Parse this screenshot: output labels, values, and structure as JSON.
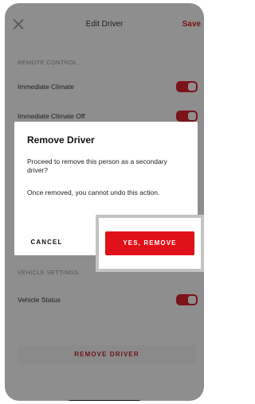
{
  "header": {
    "title": "Edit Driver",
    "save_label": "Save"
  },
  "sections": {
    "remote_control": {
      "label": "REMOTE CONTROL",
      "items": [
        {
          "label": "Immediate Climate",
          "on": true
        },
        {
          "label": "Immediate Climate Off",
          "on": true
        }
      ]
    },
    "vehicle_settings": {
      "label": "VEHICLE SETTINGS",
      "items": [
        {
          "label": "Vehicle Status",
          "on": true
        }
      ]
    }
  },
  "remove_driver_label": "REMOVE DRIVER",
  "dialog": {
    "title": "Remove Driver",
    "body1": "Proceed to remove this person as a secondary driver?",
    "body2": "Once removed, you cannot undo this action.",
    "cancel_label": "CANCEL",
    "confirm_label": "YES, REMOVE"
  },
  "colors": {
    "accent": "#e1111a",
    "overlay": "#8e8e8e"
  }
}
